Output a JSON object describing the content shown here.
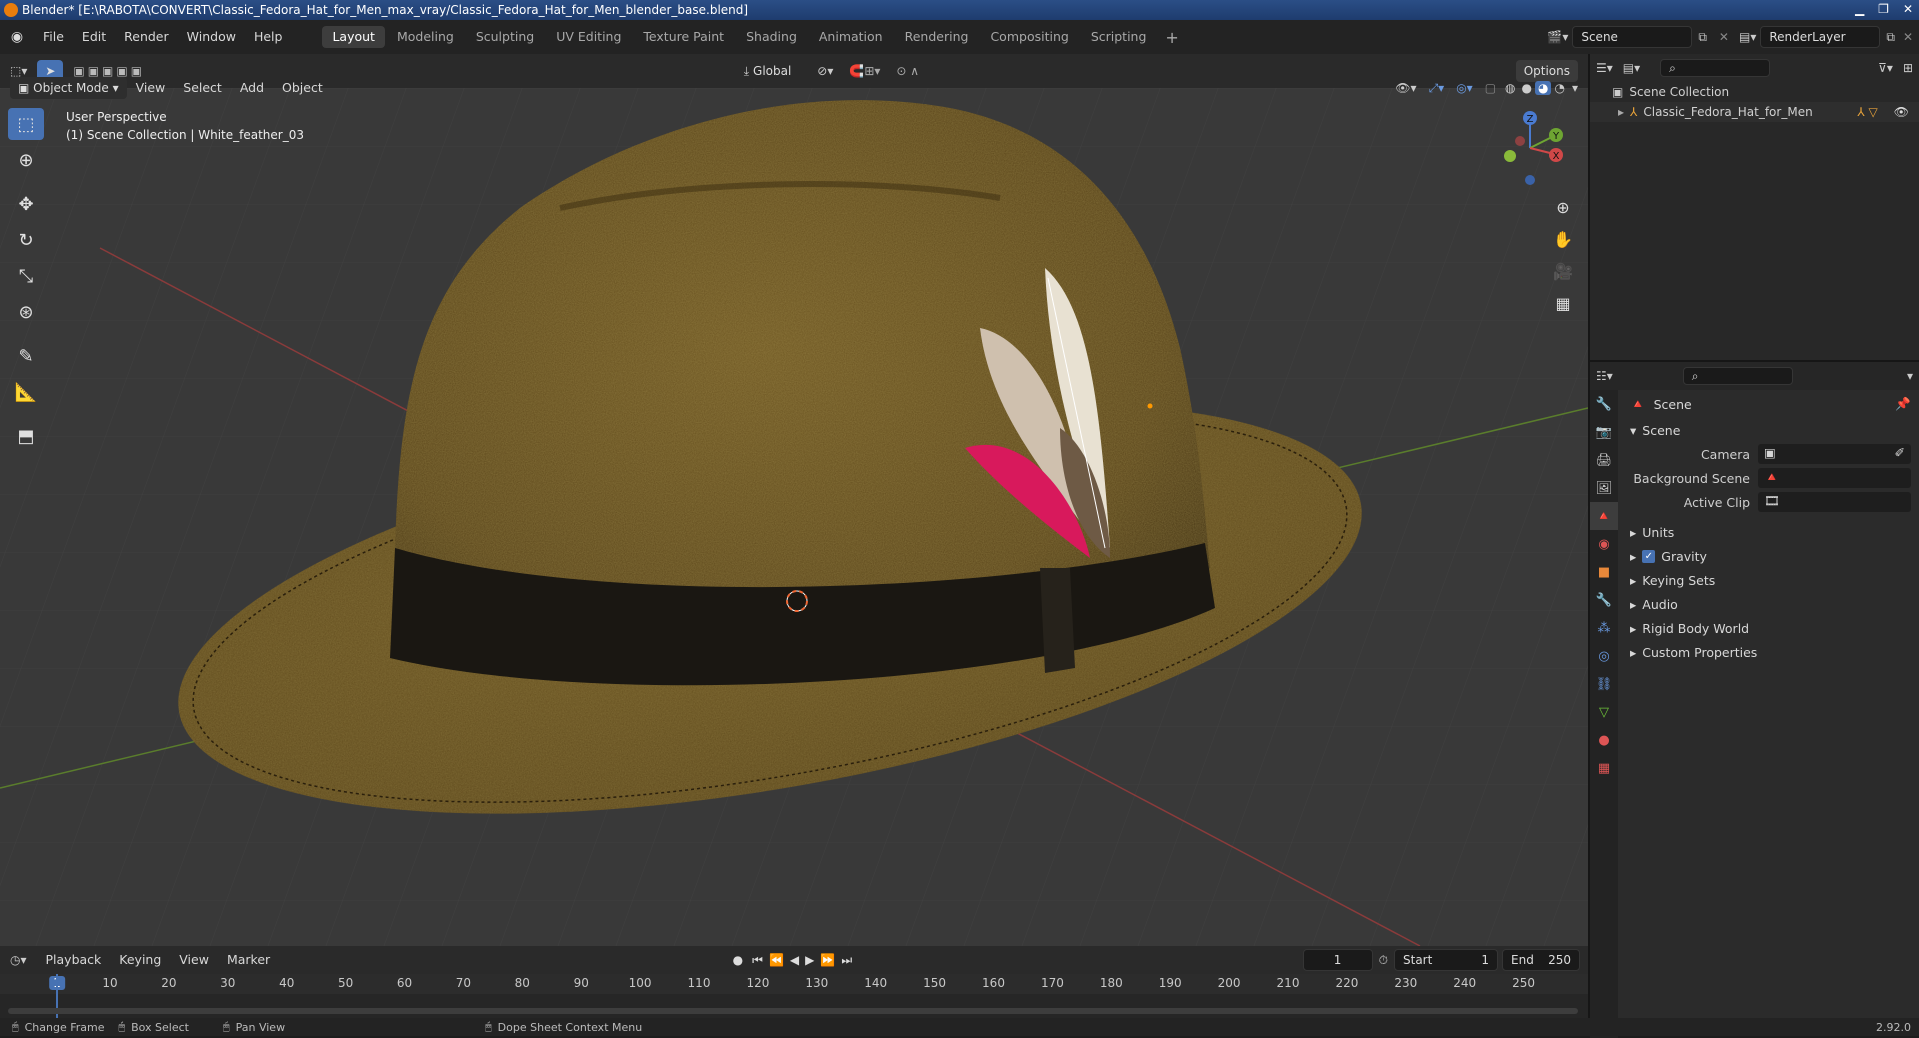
{
  "window": {
    "title": "Blender* [E:\\RABOTA\\CONVERT\\Classic_Fedora_Hat_for_Men_max_vray/Classic_Fedora_Hat_for_Men_blender_base.blend]"
  },
  "menu": [
    "File",
    "Edit",
    "Render",
    "Window",
    "Help"
  ],
  "workspaces": [
    "Layout",
    "Modeling",
    "Sculpting",
    "UV Editing",
    "Texture Paint",
    "Shading",
    "Animation",
    "Rendering",
    "Compositing",
    "Scripting"
  ],
  "active_workspace": "Layout",
  "scene_field": "Scene",
  "renderlayer_field": "RenderLayer",
  "viewport": {
    "orientation": "Global",
    "options_label": "Options",
    "mode": "Object Mode",
    "menus": [
      "View",
      "Select",
      "Add",
      "Object"
    ],
    "info_line1": "User Perspective",
    "info_line2": "(1) Scene Collection | White_feather_03"
  },
  "gizmo": {
    "x": "X",
    "y": "Y",
    "z": "Z"
  },
  "outliner": {
    "root": "Scene Collection",
    "item": "Classic_Fedora_Hat_for_Men"
  },
  "properties": {
    "context": "Scene",
    "panel": "Scene",
    "fields": [
      {
        "label": "Camera"
      },
      {
        "label": "Background Scene"
      },
      {
        "label": "Active Clip"
      }
    ],
    "subpanels": [
      "Units",
      "Gravity",
      "Keying Sets",
      "Audio",
      "Rigid Body World",
      "Custom Properties"
    ],
    "gravity_checked": true
  },
  "timeline": {
    "menus": [
      "Playback",
      "Keying",
      "View",
      "Marker"
    ],
    "current_frame": "1",
    "start_label": "Start",
    "start_value": "1",
    "end_label": "End",
    "end_value": "250",
    "ruler": [
      "1",
      "10",
      "20",
      "30",
      "40",
      "50",
      "60",
      "70",
      "80",
      "90",
      "100",
      "110",
      "120",
      "130",
      "140",
      "150",
      "160",
      "170",
      "180",
      "190",
      "200",
      "210",
      "220",
      "230",
      "240",
      "250"
    ]
  },
  "status": {
    "items": [
      "Change Frame",
      "Box Select",
      "Pan View",
      "Dope Sheet Context Menu"
    ],
    "version": "2.92.0"
  },
  "colors": {
    "accent": "#4772b3",
    "hat_felt": "#6b5320",
    "band": "#1a1712",
    "feather_pink": "#d8195c"
  }
}
